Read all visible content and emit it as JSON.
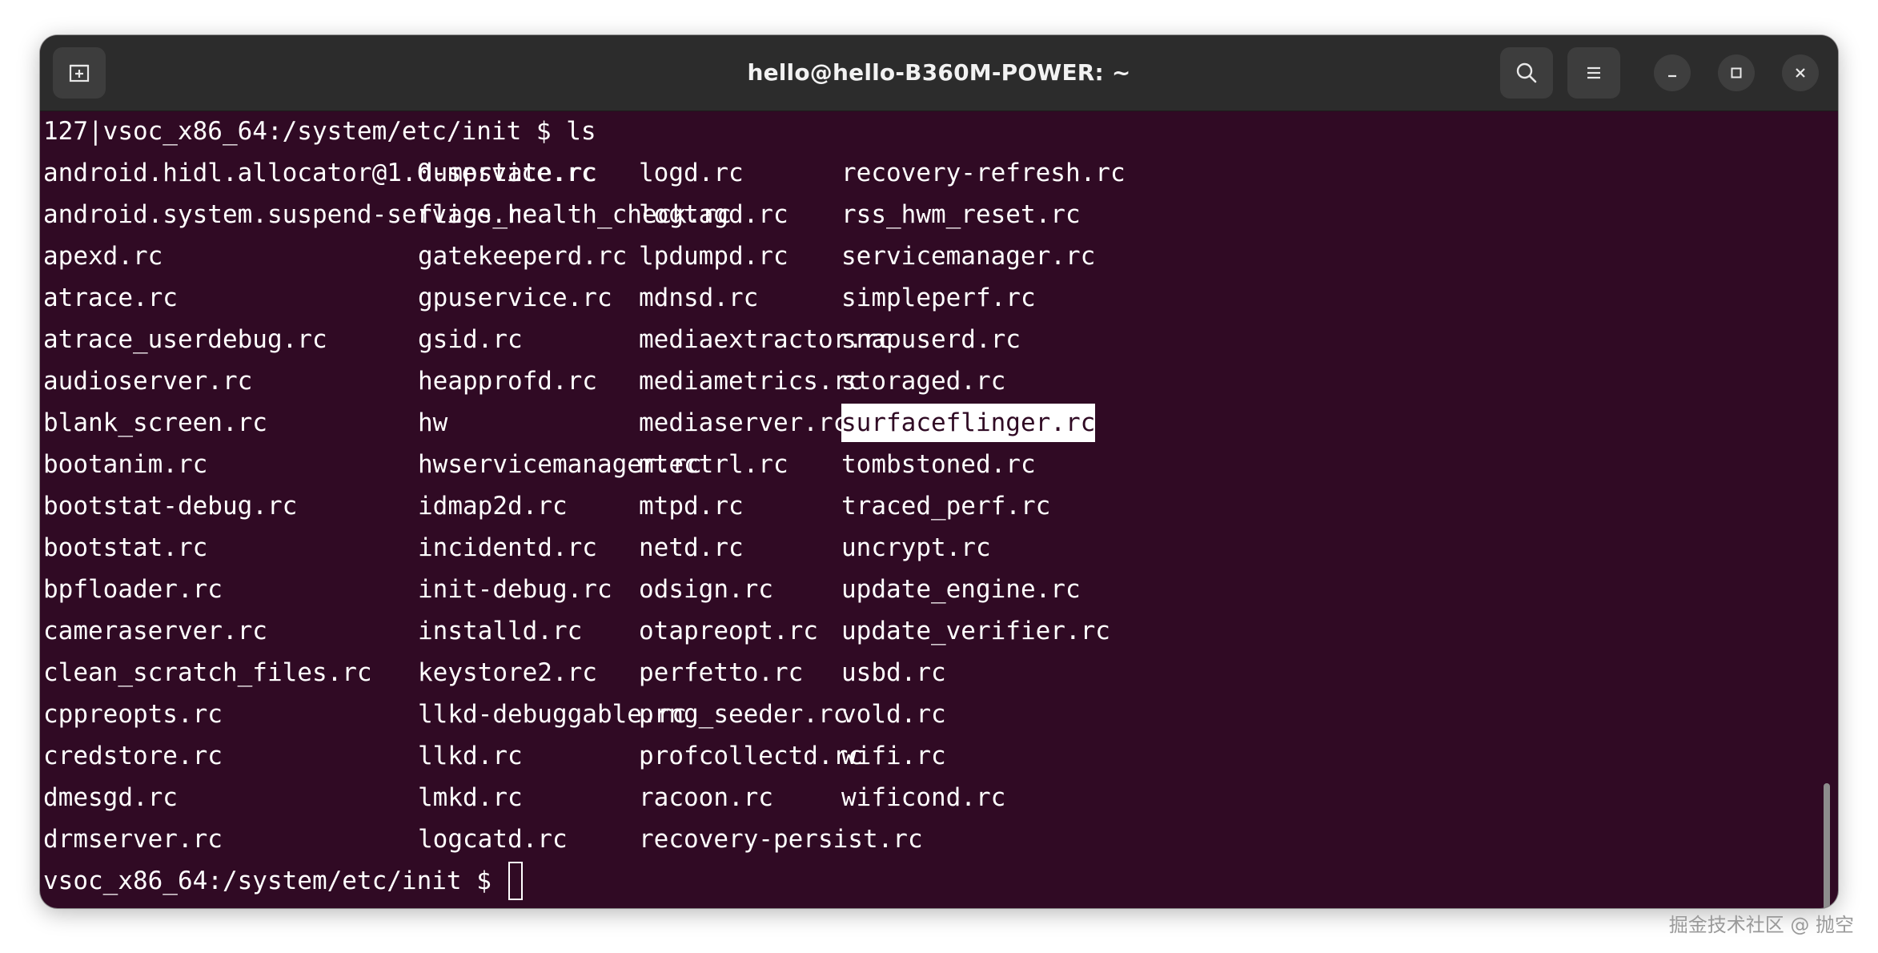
{
  "window": {
    "title": "hello@hello-B360M-POWER: ~"
  },
  "headerbar": {
    "new_tab_icon": "new-tab-icon",
    "search_icon": "search-icon",
    "menu_icon": "hamburger-menu-icon",
    "minimize_icon": "minimize-icon",
    "maximize_icon": "maximize-icon",
    "close_icon": "close-icon"
  },
  "terminal": {
    "command_line": "127|vsoc_x86_64:/system/etc/init $ ls",
    "prompt_line": "vsoc_x86_64:/system/etc/init $ ",
    "selected_item": "surfaceflinger.rc",
    "columns": [
      [
        "android.hidl.allocator@1.0-service.rc",
        "android.system.suspend-service.rc",
        "apexd.rc",
        "atrace.rc",
        "atrace_userdebug.rc",
        "audioserver.rc",
        "blank_screen.rc",
        "bootanim.rc",
        "bootstat-debug.rc",
        "bootstat.rc",
        "bpfloader.rc",
        "cameraserver.rc",
        "clean_scratch_files.rc",
        "cppreopts.rc",
        "credstore.rc",
        "dmesgd.rc",
        "drmserver.rc"
      ],
      [
        "dumpstate.rc",
        "flags_health_check.rc",
        "gatekeeperd.rc",
        "gpuservice.rc",
        "gsid.rc",
        "heapprofd.rc",
        "hw",
        "hwservicemanager.rc",
        "idmap2d.rc",
        "incidentd.rc",
        "init-debug.rc",
        "installd.rc",
        "keystore2.rc",
        "llkd-debuggable.rc",
        "llkd.rc",
        "lmkd.rc",
        "logcatd.rc"
      ],
      [
        "logd.rc",
        "logtagd.rc",
        "lpdumpd.rc",
        "mdnsd.rc",
        "mediaextractor.rc",
        "mediametrics.rc",
        "mediaserver.rc",
        "mtectrl.rc",
        "mtpd.rc",
        "netd.rc",
        "odsign.rc",
        "otapreopt.rc",
        "perfetto.rc",
        "prng_seeder.rc",
        "profcollectd.rc",
        "racoon.rc",
        "recovery-persist.rc"
      ],
      [
        "recovery-refresh.rc",
        "rss_hwm_reset.rc",
        "servicemanager.rc",
        "simpleperf.rc",
        "snapuserd.rc",
        "storaged.rc",
        "surfaceflinger.rc",
        "tombstoned.rc",
        "traced_perf.rc",
        "uncrypt.rc",
        "update_engine.rc",
        "update_verifier.rc",
        "usbd.rc",
        "vold.rc",
        "wifi.rc",
        "wificond.rc"
      ]
    ]
  },
  "watermark": "掘金技术社区 @ 抛空"
}
